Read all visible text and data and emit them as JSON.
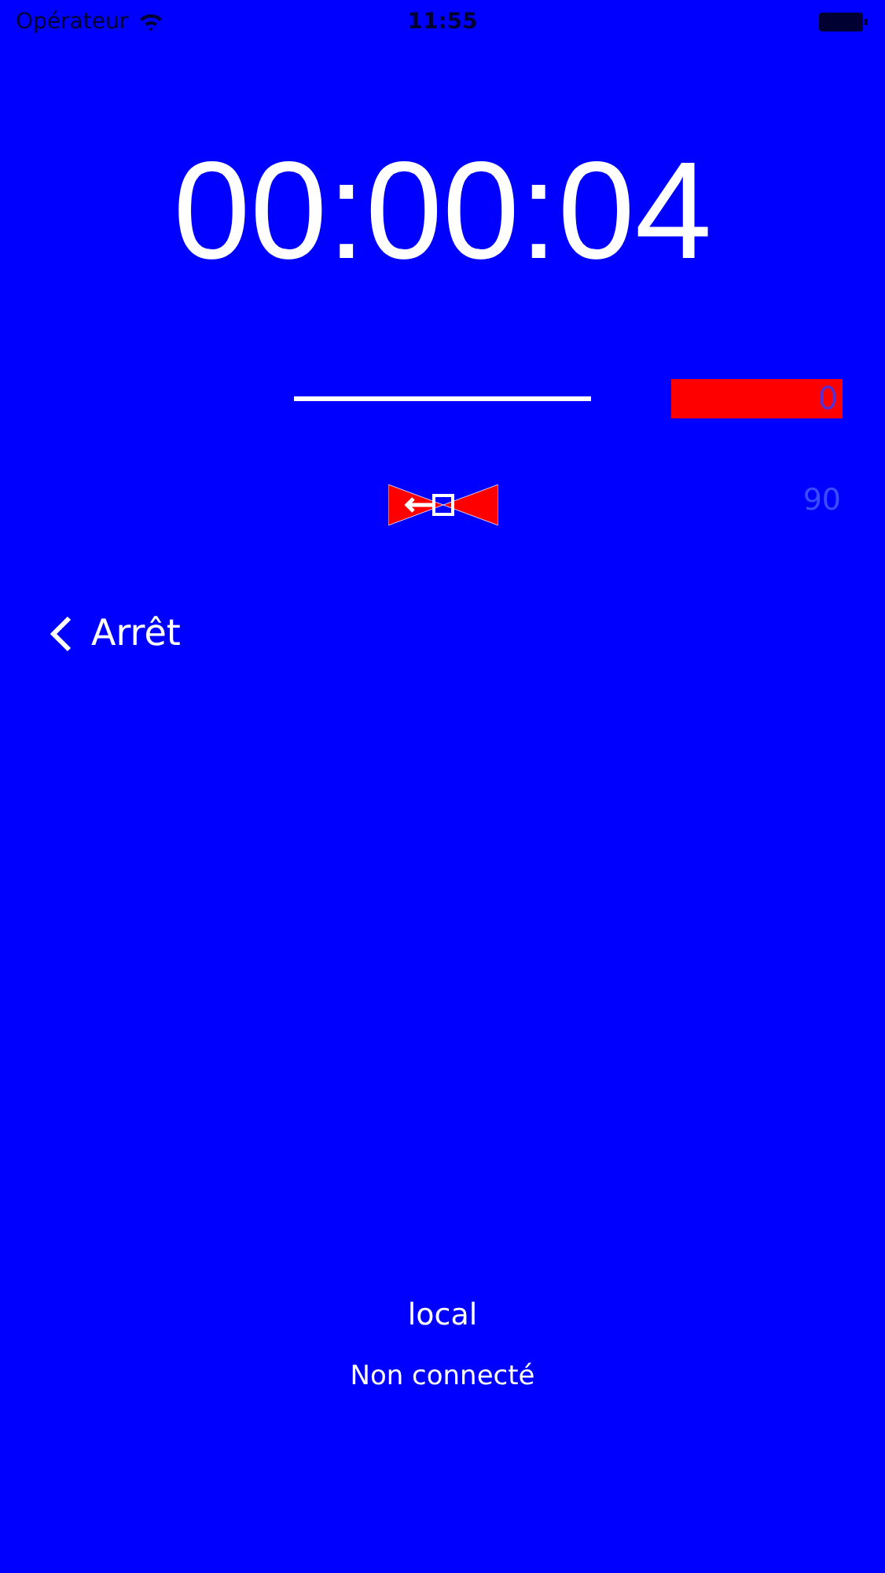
{
  "status_bar": {
    "carrier": "Opérateur",
    "time": "11:55"
  },
  "timer": "00:00:04",
  "counter": "0",
  "angle": "90",
  "back_button": "Arrêt",
  "mode": "local",
  "connection": "Non connecté"
}
